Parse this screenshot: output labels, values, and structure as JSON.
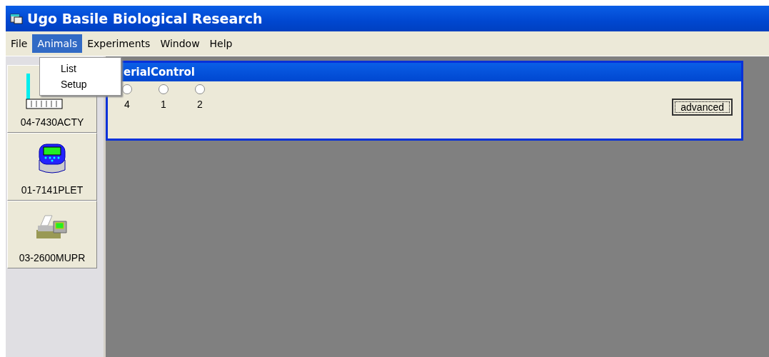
{
  "window": {
    "title": "Ugo Basile Biological Research"
  },
  "menu": [
    {
      "label": "File",
      "selected": false
    },
    {
      "label": "Animals",
      "selected": true
    },
    {
      "label": "Experiments",
      "selected": false
    },
    {
      "label": "Window",
      "selected": false
    },
    {
      "label": "Help",
      "selected": false
    }
  ],
  "dropdown": {
    "items": [
      "List",
      "Setup"
    ]
  },
  "sidebar": {
    "items": [
      {
        "kind": "activity",
        "label": "04-7430ACTY"
      },
      {
        "kind": "plethysmometer",
        "label": "01-7141PLET"
      },
      {
        "kind": "printer",
        "label": "03-2600MUPR"
      }
    ]
  },
  "serial_control": {
    "title": "erialControl",
    "radios": [
      {
        "label": "4",
        "selected": false
      },
      {
        "label": "1",
        "selected": false
      },
      {
        "label": "2",
        "selected": false
      }
    ],
    "button": "advanced"
  }
}
